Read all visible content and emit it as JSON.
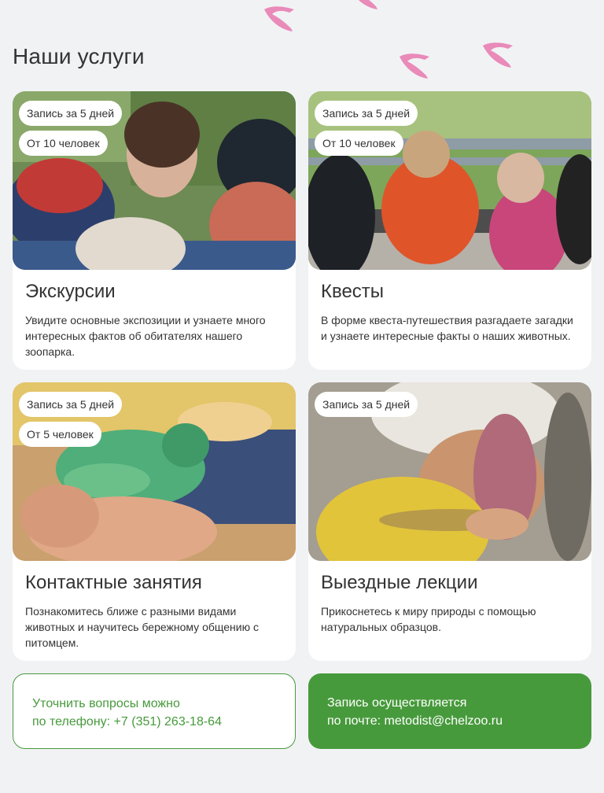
{
  "section_title": "Наши услуги",
  "colors": {
    "accent_green": "#479a3c",
    "paw_pink": "#e98ab9",
    "background": "#f1f2f4"
  },
  "services": [
    {
      "title": "Экскурсии",
      "tags": [
        "Запись за 5 дней",
        "От 10 человек"
      ],
      "description": "Увидите основные экспозиции и узнаете много интересных фактов об обитателях нашего зоопарка."
    },
    {
      "title": "Квесты",
      "tags": [
        "Запись за 5 дней",
        "От 10 человек"
      ],
      "description": "В форме квеста-путешествия разгадаете загадки и узнаете интересные факты о наших животных."
    },
    {
      "title": "Контактные занятия",
      "tags": [
        "Запись за 5 дней",
        "От 5 человек"
      ],
      "description": "Познакомитесь ближе с разными видами животных и научитесь бережному общению с питомцем."
    },
    {
      "title": "Выездные лекции",
      "tags": [
        "Запись за 5 дней"
      ],
      "description": "Прикоснетесь к миру природы с помощью натуральных образцов."
    }
  ],
  "contacts": {
    "phone_line1": "Уточнить вопросы можно",
    "phone_line2": "по телефону: +7 (351) 263-18-64",
    "email_line1": "Запись осуществляется",
    "email_line2": "по почте: metodist@chelzoo.ru"
  }
}
